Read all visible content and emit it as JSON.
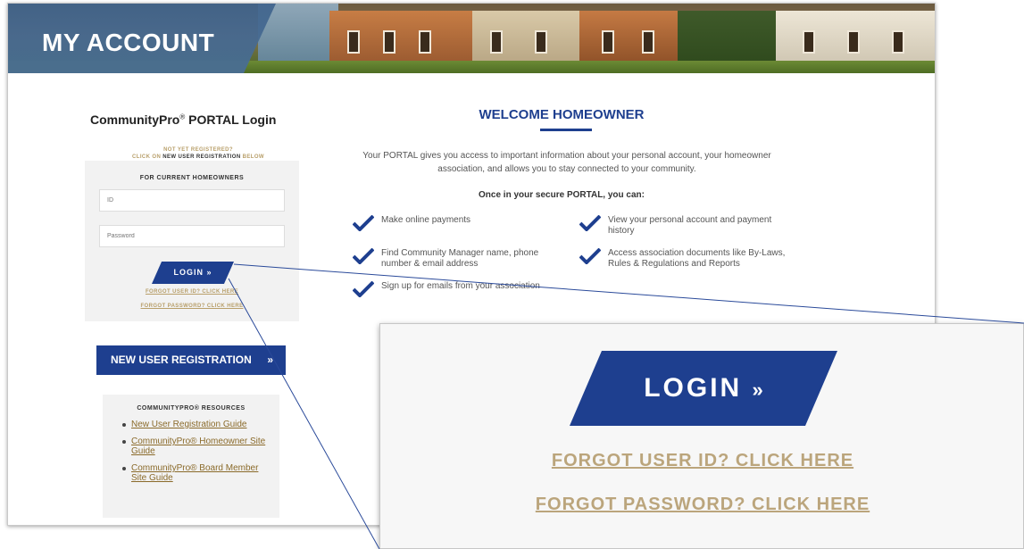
{
  "hero": {
    "title": "MY ACCOUNT"
  },
  "login": {
    "heading": "CommunityPro",
    "heading_mark": "®",
    "heading_rest": " PORTAL Login",
    "not_registered_line1": "NOT YET REGISTERED?",
    "not_registered_prefix": "CLICK ON ",
    "not_registered_bold": "NEW USER REGISTRATION",
    "not_registered_suffix": " BELOW",
    "panel_label": "FOR CURRENT HOMEOWNERS",
    "id_placeholder": "ID",
    "password_placeholder": "Password",
    "login_label": "LOGIN »",
    "forgot_id": "FORGOT USER ID? CLICK HERE",
    "forgot_password": "FORGOT PASSWORD? CLICK HERE"
  },
  "new_user": {
    "label": "NEW USER REGISTRATION",
    "arrow": "»"
  },
  "resources": {
    "title": "COMMUNITYPRO® RESOURCES",
    "items": [
      "New User Registration Guide",
      "CommunityPro® Homeowner Site Guide",
      "CommunityPro® Board Member Site Guide"
    ]
  },
  "welcome": {
    "title": "WELCOME HOMEOWNER",
    "description": "Your PORTAL gives you access to important information about your personal account, your homeowner association, and allows you to stay connected to your community.",
    "subtitle": "Once in your secure PORTAL, you can:",
    "features": [
      "Make online payments",
      "View your personal account and payment history",
      "Find Community Manager name, phone number & email address",
      "Access association documents like By-Laws, Rules & Regulations and Reports",
      "Sign up for emails from your association"
    ]
  },
  "zoom": {
    "login_label": "LOGIN",
    "login_arrow": "»",
    "forgot_id": "FORGOT USER ID? CLICK HERE",
    "forgot_password": "FORGOT PASSWORD? CLICK HERE"
  },
  "colors": {
    "brand_blue": "#1e3f8f",
    "gold_link": "#b89f6a",
    "panel_gray": "#f2f2f2"
  }
}
